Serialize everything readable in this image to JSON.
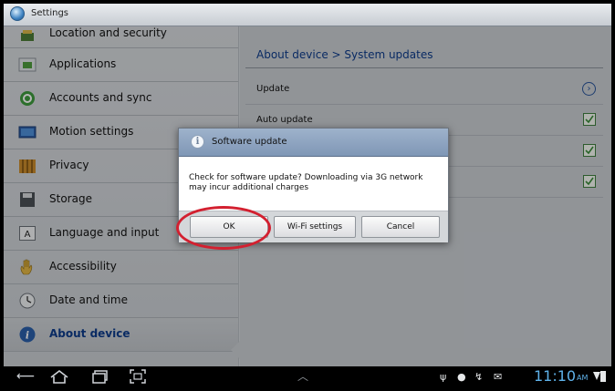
{
  "titlebar": {
    "title": "Settings"
  },
  "sidebar": {
    "items": [
      {
        "label": "Location and security",
        "icon": "location-security-icon"
      },
      {
        "label": "Applications",
        "icon": "applications-icon"
      },
      {
        "label": "Accounts and sync",
        "icon": "accounts-sync-icon"
      },
      {
        "label": "Motion settings",
        "icon": "motion-icon"
      },
      {
        "label": "Privacy",
        "icon": "privacy-icon"
      },
      {
        "label": "Storage",
        "icon": "storage-icon"
      },
      {
        "label": "Language and input",
        "icon": "language-icon"
      },
      {
        "label": "Accessibility",
        "icon": "accessibility-icon"
      },
      {
        "label": "Date and time",
        "icon": "clock-icon"
      },
      {
        "label": "About device",
        "icon": "info-icon",
        "active": true
      }
    ]
  },
  "main": {
    "breadcrumb": "About device  >  System updates",
    "rows": [
      {
        "label": "Update",
        "control": "arrow"
      },
      {
        "label": "Auto update",
        "control": "checkbox",
        "checked": true
      },
      {
        "label": "",
        "control": "checkbox",
        "checked": true
      },
      {
        "label": "",
        "control": "checkbox",
        "checked": true
      }
    ]
  },
  "dialog": {
    "title": "Software update",
    "message": "Check for software update? Downloading via 3G network may incur additional charges",
    "buttons": {
      "ok": "OK",
      "wifi": "Wi-Fi settings",
      "cancel": "Cancel"
    }
  },
  "statusbar": {
    "time": "11:10",
    "ampm": "AM"
  },
  "colors": {
    "accent_blue": "#0d3b8a",
    "clock_blue": "#5fb2ea",
    "highlight_red": "#d32030"
  }
}
